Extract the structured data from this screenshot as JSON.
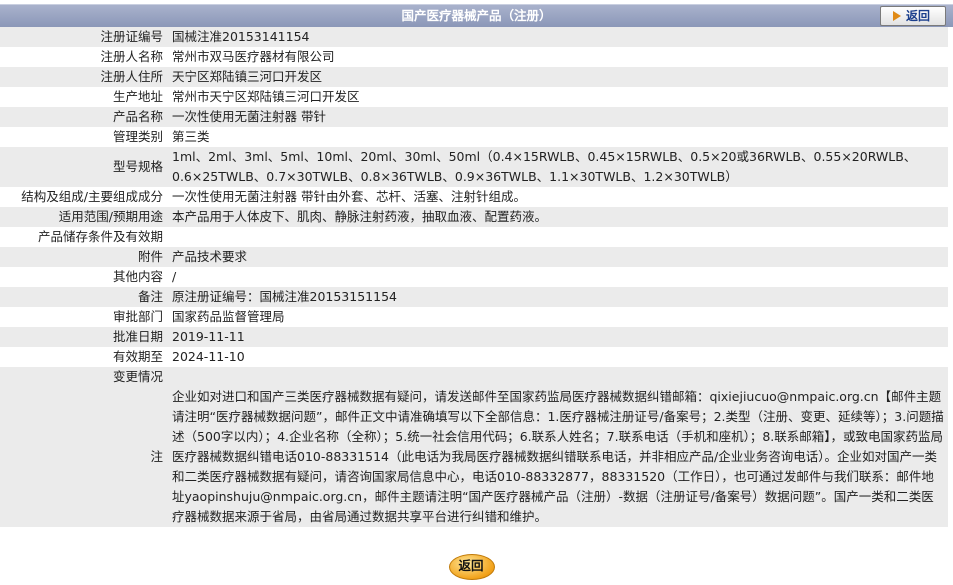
{
  "header": {
    "title": "国产医疗器械产品（注册）",
    "back_label": "返回"
  },
  "rows": [
    {
      "label": "注册证编号",
      "value": "国械注准20153141154"
    },
    {
      "label": "注册人名称",
      "value": "常州市双马医疗器材有限公司"
    },
    {
      "label": "注册人住所",
      "value": "天宁区郑陆镇三河口开发区"
    },
    {
      "label": "生产地址",
      "value": "常州市天宁区郑陆镇三河口开发区"
    },
    {
      "label": "产品名称",
      "value": "一次性使用无菌注射器 带针"
    },
    {
      "label": "管理类别",
      "value": "第三类"
    },
    {
      "label": "型号规格",
      "value": "1ml、2ml、3ml、5ml、10ml、20ml、30ml、50ml（0.4×15RWLB、0.45×15RWLB、0.5×20或36RWLB、0.55×20RWLB、0.6×25TWLB、0.7×30TWLB、0.8×36TWLB、0.9×36TWLB、1.1×30TWLB、1.2×30TWLB）"
    },
    {
      "label": "结构及组成/主要组成成分",
      "value": "一次性使用无菌注射器 带针由外套、芯杆、活塞、注射针组成。"
    },
    {
      "label": "适用范围/预期用途",
      "value": "本产品用于人体皮下、肌肉、静脉注射药液，抽取血液、配置药液。"
    },
    {
      "label": "产品储存条件及有效期",
      "value": ""
    },
    {
      "label": "附件",
      "value": "产品技术要求"
    },
    {
      "label": "其他内容",
      "value": "/"
    },
    {
      "label": "备注",
      "value": "原注册证编号：国械注准20153151154"
    },
    {
      "label": "审批部门",
      "value": "国家药品监督管理局"
    },
    {
      "label": "批准日期",
      "value": "2019-11-11"
    },
    {
      "label": "有效期至",
      "value": "2024-11-10"
    },
    {
      "label": "变更情况",
      "value": ""
    }
  ],
  "note": {
    "label": "注",
    "text": "企业如对进口和国产三类医疗器械数据有疑问，请发送邮件至国家药监局医疗器械数据纠错邮箱：qixiejiucuo@nmpaic.org.cn【邮件主题请注明“医疗器械数据问题”，邮件正文中请准确填写以下全部信息：1.医疗器械注册证号/备案号；2.类型（注册、变更、延续等）；3.问题描述（500字以内）；4.企业名称（全称）；5.统一社会信用代码；6.联系人姓名；7.联系电话（手机和座机）；8.联系邮箱】，或致电国家药监局医疗器械数据纠错电话010-88331514（此电话为我局医疗器械数据纠错联系电话，并非相应产品/企业业务咨询电话）。企业如对国产一类和二类医疗器械数据有疑问，请咨询国家局信息中心，电话010-88332877，88331520（工作日），也可通过发邮件与我们联系：邮件地址yaopinshuju@nmpaic.org.cn，邮件主题请注明“国产医疗器械产品（注册）-数据（注册证号/备案号）数据问题”。国产一类和二类医疗器械数据来源于省局，由省局通过数据共享平台进行纠错和维护。"
  },
  "footer": {
    "back_label": "返回"
  }
}
